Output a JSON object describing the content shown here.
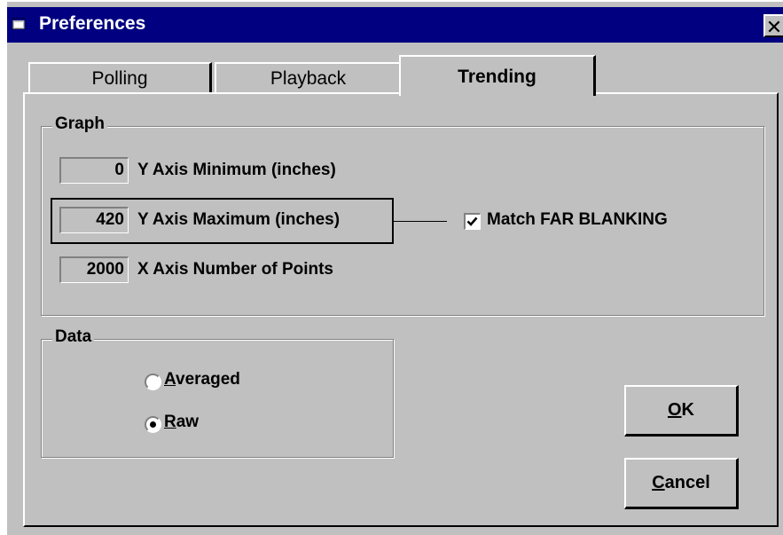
{
  "window": {
    "title": "Preferences",
    "close_glyph": "✕",
    "icon": "app-window-icon"
  },
  "tabs": [
    {
      "label": "Polling",
      "active": false
    },
    {
      "label": "Playback",
      "active": false
    },
    {
      "label": "Trending",
      "active": true
    }
  ],
  "graph": {
    "label": "Graph",
    "y_min": {
      "value": "0",
      "label": "Y Axis Minimum (inches)"
    },
    "y_max": {
      "value": "420",
      "label": "Y Axis Maximum (inches)"
    },
    "x_points": {
      "value": "2000",
      "label": "X Axis Number of Points"
    },
    "match_far_blanking": {
      "label": "Match FAR BLANKING",
      "checked": true
    }
  },
  "data_group": {
    "label": "Data",
    "averaged": {
      "mnemonic": "A",
      "rest": "veraged",
      "selected": false
    },
    "raw": {
      "mnemonic": "R",
      "rest": "aw",
      "selected": true
    }
  },
  "buttons": {
    "ok": {
      "mnemonic": "O",
      "rest": "K"
    },
    "cancel": {
      "mnemonic": "C",
      "rest": "ancel"
    }
  },
  "colors": {
    "titlebar": "#000080",
    "face": "#c0c0c0",
    "shadow": "#808080"
  }
}
